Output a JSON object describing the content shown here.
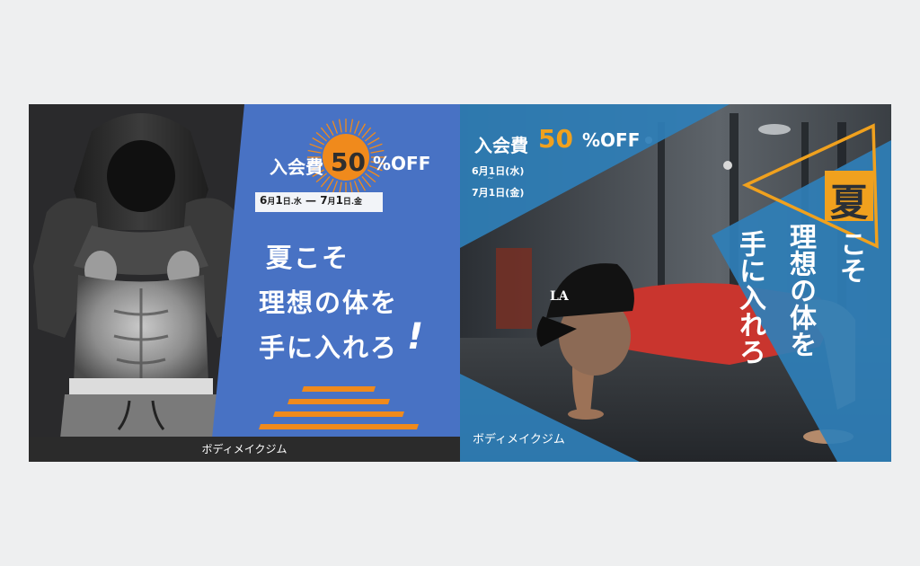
{
  "banner_left": {
    "price_label": "入会費",
    "discount_number": "50",
    "discount_suffix": "%OFF",
    "period": {
      "start_month": "6",
      "start_month_unit": "月",
      "start_day": "1",
      "start_day_unit": "日",
      "start_weekday": "水",
      "separator": "—",
      "end_month": "7",
      "end_month_unit": "月",
      "end_day": "1",
      "end_day_unit": "日",
      "end_weekday": "金"
    },
    "headline_line1": "夏こそ",
    "headline_line2": "理想の体を",
    "headline_line3": "手に入れろ",
    "exclamation": "!",
    "brand": "ボディメイクジム"
  },
  "banner_right": {
    "price_label": "入会費",
    "discount_number": "50",
    "discount_suffix": "%OFF",
    "period_start": "6月1日(水)",
    "period_tilde": "~",
    "period_end": "7月1日(金)",
    "summer_char": "夏",
    "headline_col1": "こそ",
    "headline_col2": "理想の体を",
    "headline_col3": "手に入れろ",
    "cap_logo": "LA",
    "brand": "ボディメイクジム"
  },
  "colors": {
    "blue_panel": "#4872c4",
    "orange_accent": "#f08a1c",
    "teal_panel": "#2f7fb8",
    "gold": "#f0a11e",
    "dark_bg": "#2a2a2c"
  }
}
